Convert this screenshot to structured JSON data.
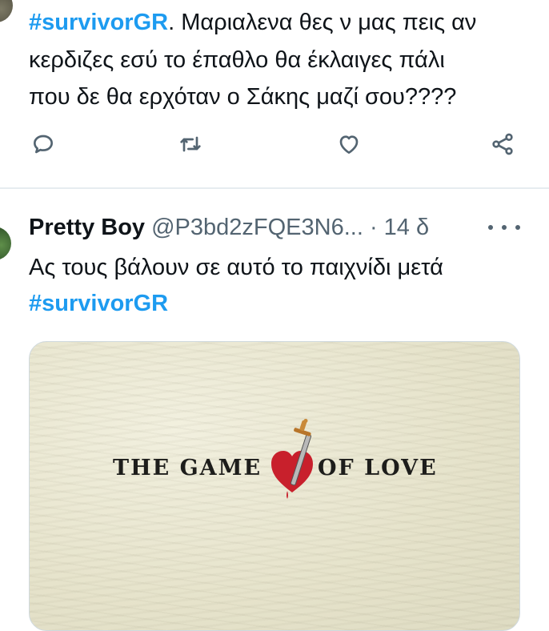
{
  "tweet1": {
    "hashtag": "#survivorGR",
    "line1_rest": ". Μαριαλενα θες ν μας πεις αν",
    "line2": "κερδιζες εσύ το έπαθλο θα έκλαιγες πάλι",
    "line3": "που δε θα ερχόταν ο  Σάκης μαζί σου????"
  },
  "tweet1_actions": {
    "reply_icon": "reply-icon",
    "retweet_icon": "retweet-icon",
    "like_icon": "heart-icon",
    "share_icon": "share-icon"
  },
  "tweet2": {
    "name": "Pretty Boy",
    "handle": "@P3bd2zFQE3N6...",
    "time": " · 14 δ",
    "text": "Ας τους βάλουν σε αυτό το παιχνίδι μετά",
    "hashtag": "#survivorGR"
  },
  "media": {
    "logo_left": "THE GAME",
    "logo_right": "OF LOVE",
    "logo_icon": "heart-dagger-icon"
  },
  "colors": {
    "accent": "#1d9bf0",
    "text": "#0f1419",
    "secondary": "#536471",
    "heart_red": "#c8202c"
  }
}
